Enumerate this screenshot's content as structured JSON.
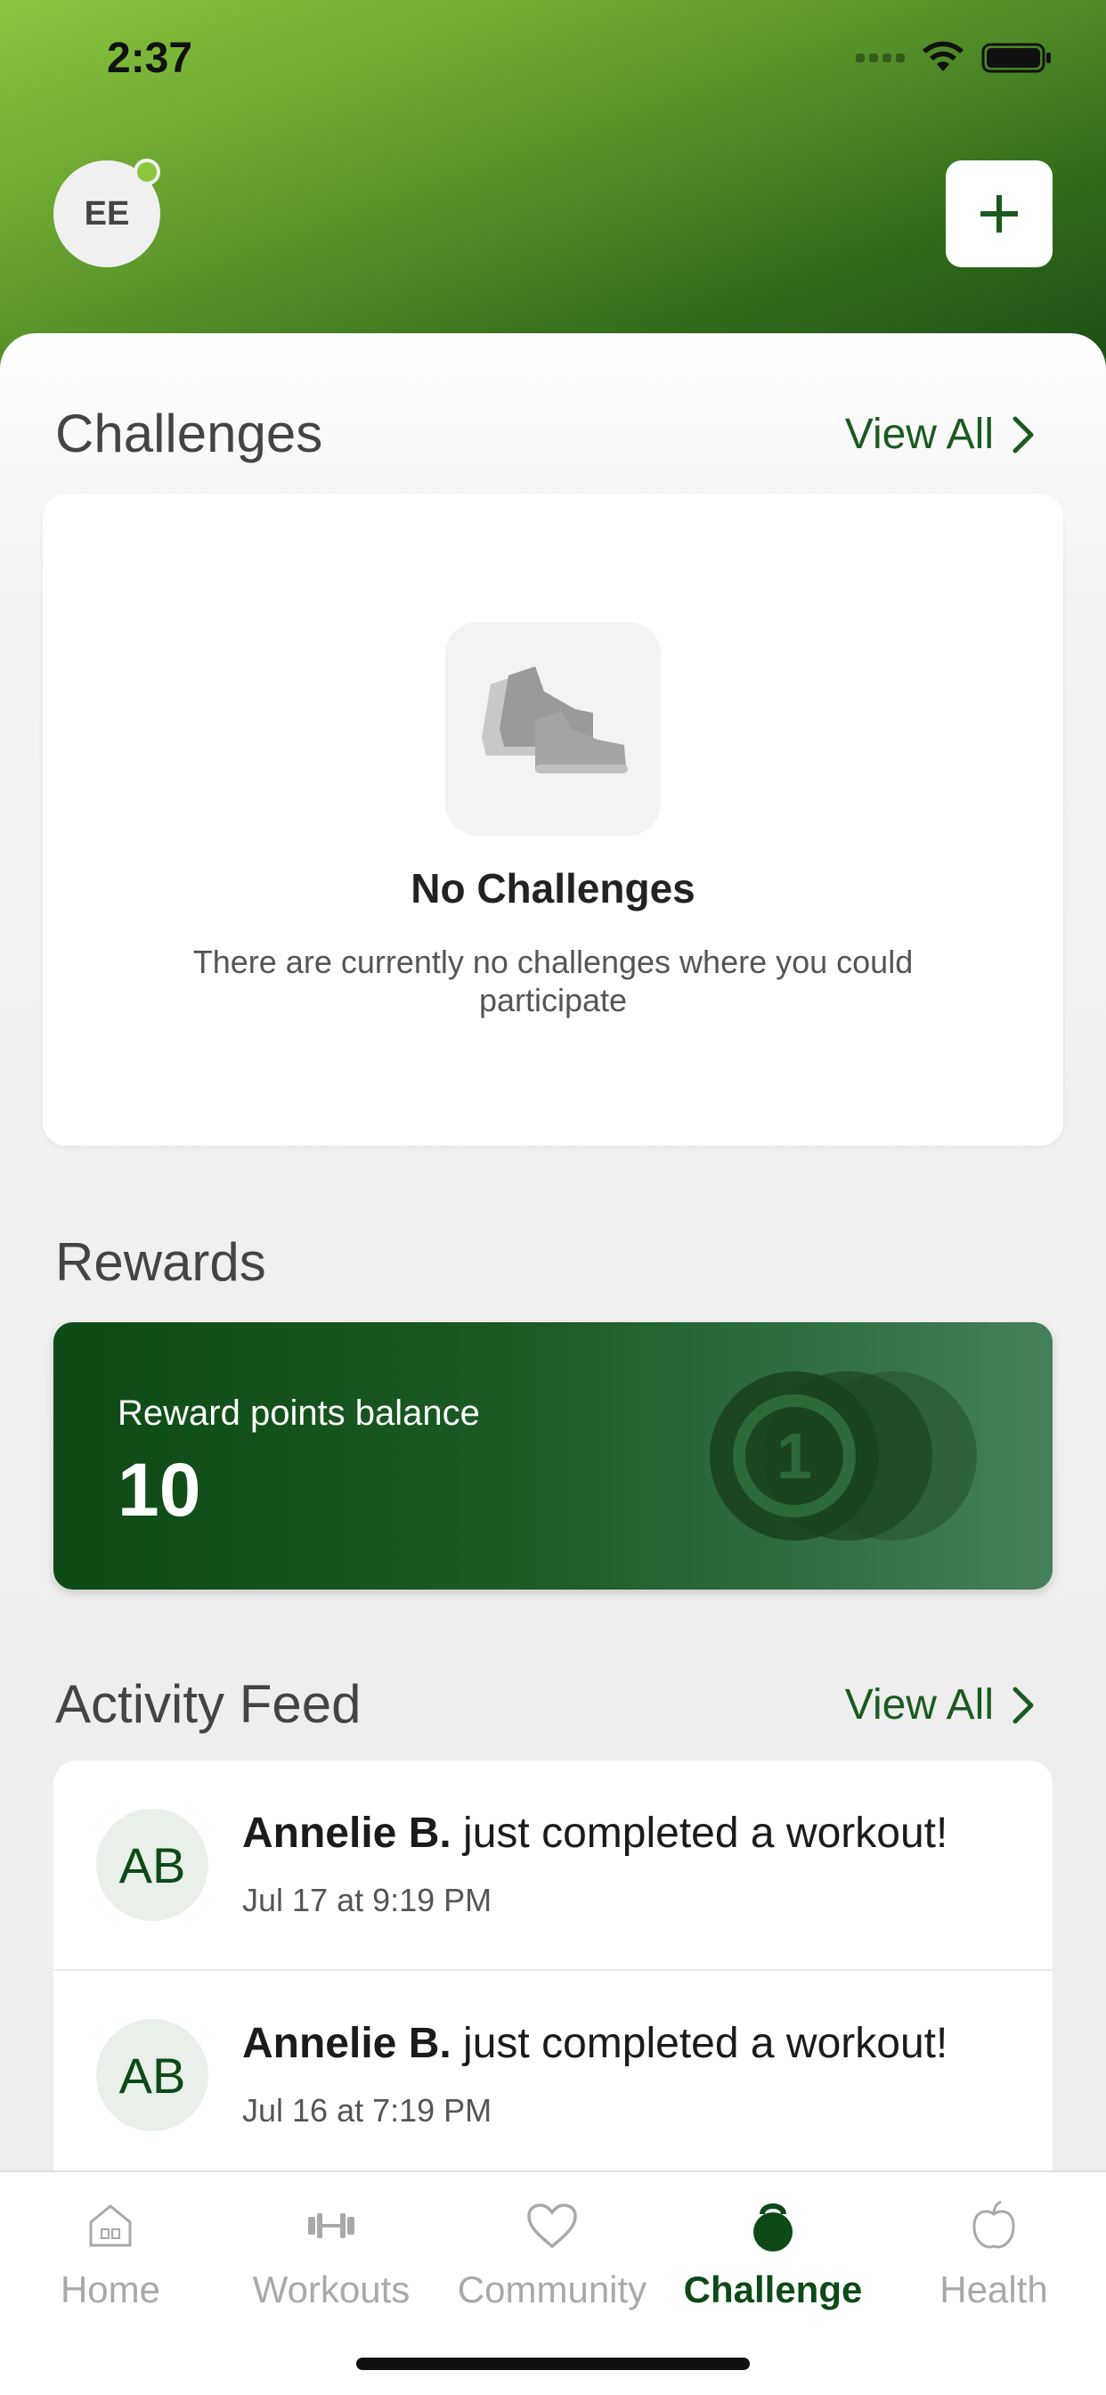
{
  "status_bar": {
    "time": "2:37"
  },
  "header": {
    "avatar_initials": "EE",
    "add_button_label": "+"
  },
  "challenges": {
    "title": "Challenges",
    "view_all": "View All",
    "empty_title": "No Challenges",
    "empty_subtitle": "There are currently no challenges where you could participate"
  },
  "rewards": {
    "title": "Rewards",
    "balance_label": "Reward points balance",
    "balance_value": "10",
    "coin_number": "1"
  },
  "activity_feed": {
    "title": "Activity Feed",
    "view_all": "View All",
    "items": [
      {
        "initials": "AB",
        "name": "Annelie B.",
        "action": "just completed a workout!",
        "time": "Jul 17 at 9:19 PM"
      },
      {
        "initials": "AB",
        "name": "Annelie B.",
        "action": "just completed a workout!",
        "time": "Jul 16 at 7:19 PM"
      }
    ]
  },
  "tabbar": {
    "tabs": [
      {
        "label": "Home",
        "icon": "home-icon"
      },
      {
        "label": "Workouts",
        "icon": "dumbbell-icon"
      },
      {
        "label": "Community",
        "icon": "heart-icon"
      },
      {
        "label": "Challenge",
        "icon": "kettlebell-icon",
        "active": true
      },
      {
        "label": "Health",
        "icon": "apple-icon"
      }
    ]
  },
  "colors": {
    "brand_dark_green": "#0e4a17",
    "accent_light_green": "#8cc63f"
  }
}
